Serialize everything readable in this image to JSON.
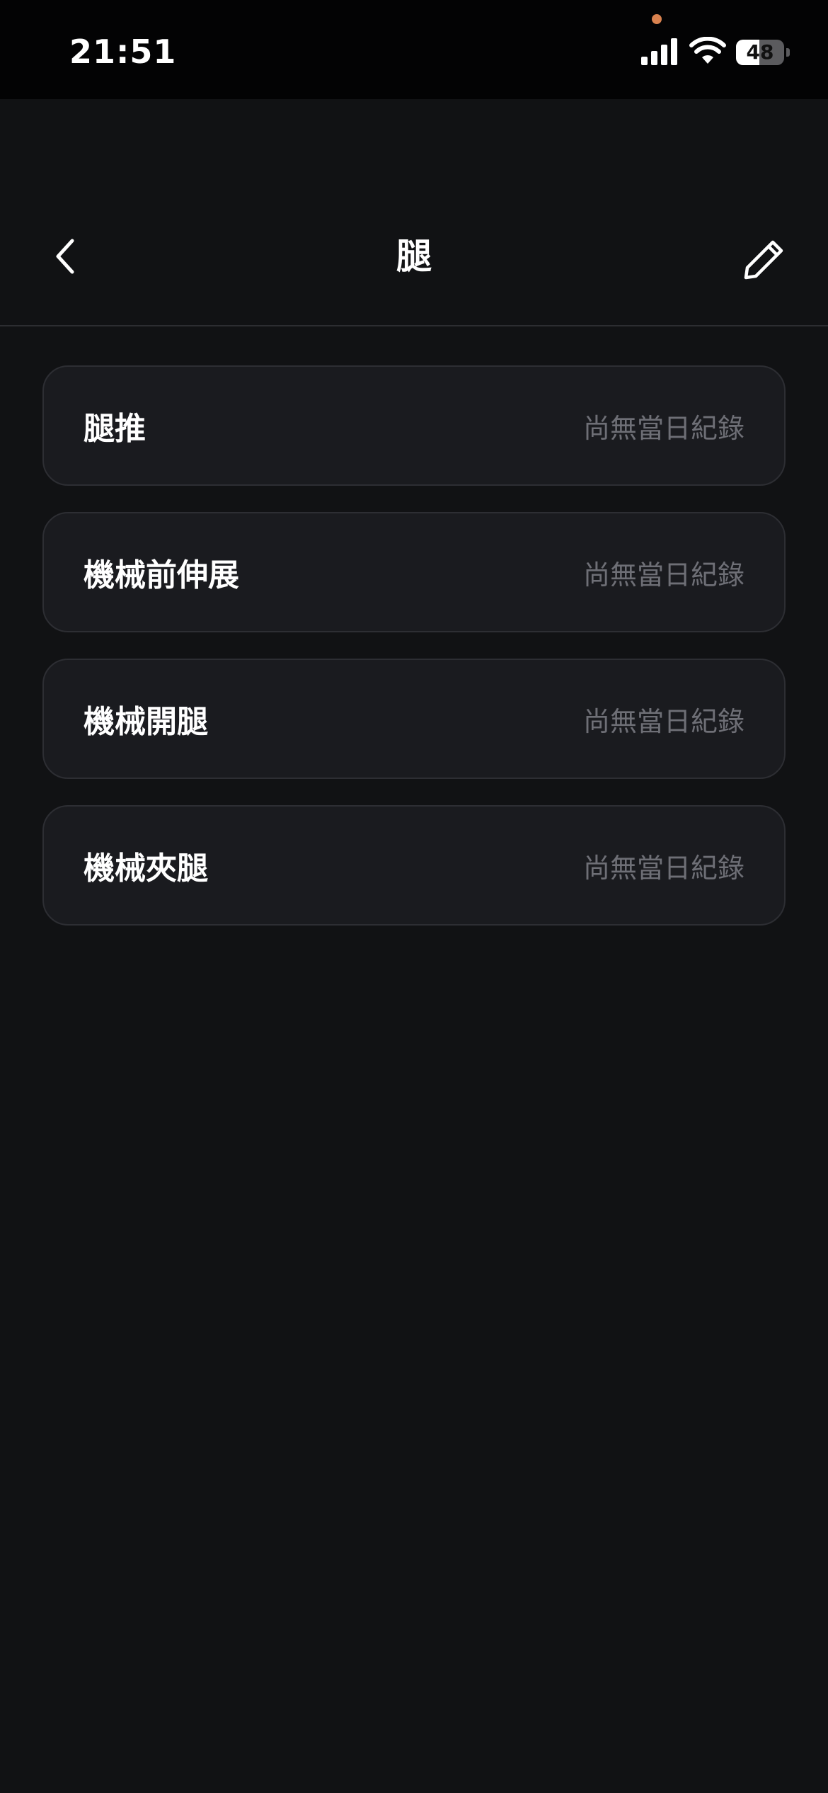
{
  "status_bar": {
    "time": "21:51",
    "battery_level": "48",
    "battery_fraction": 0.48,
    "camera_indicator_color": "#d9824f",
    "icons": [
      "signal-icon",
      "wifi-icon",
      "battery-icon"
    ]
  },
  "header": {
    "title": "腿",
    "back_icon": "chevron-left-icon",
    "edit_icon": "pencil-icon"
  },
  "exercises": [
    {
      "name": "腿推",
      "status": "尚無當日紀錄"
    },
    {
      "name": "機械前伸展",
      "status": "尚無當日紀錄"
    },
    {
      "name": "機械開腿",
      "status": "尚無當日紀錄"
    },
    {
      "name": "機械夾腿",
      "status": "尚無當日紀錄"
    }
  ],
  "colors": {
    "background": "#111214",
    "card_background": "#1a1b1f",
    "card_border": "#2d2e33",
    "status_text": "#6e6f76"
  }
}
